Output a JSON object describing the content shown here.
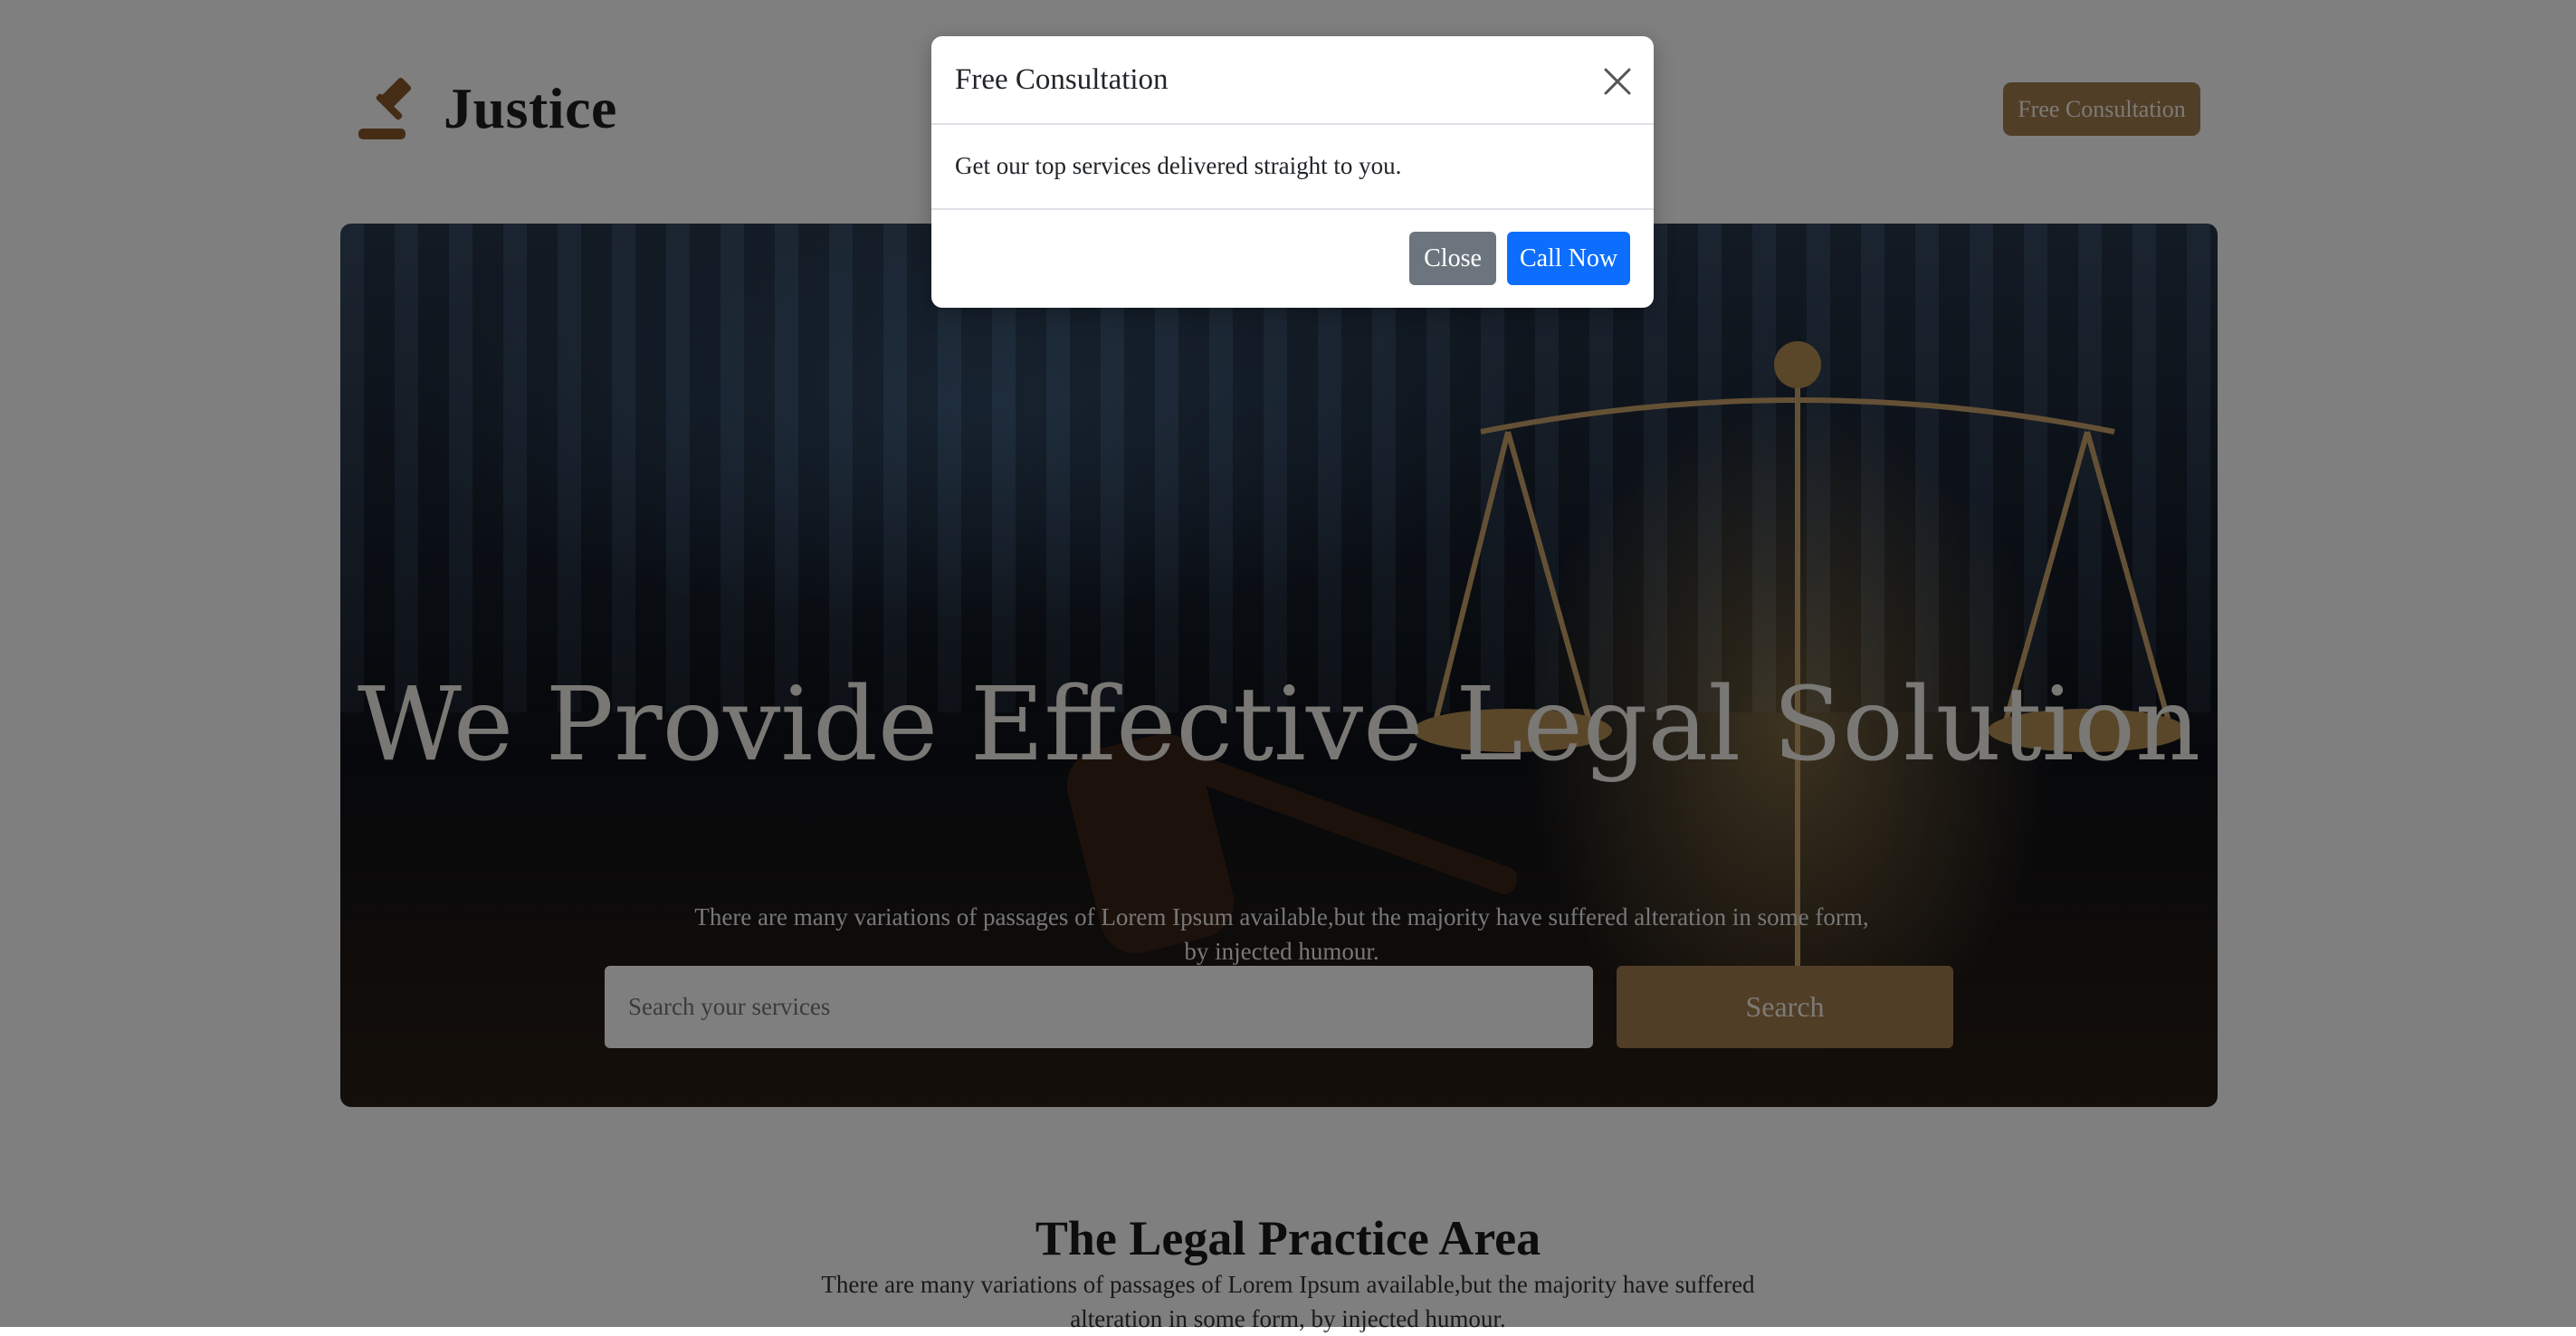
{
  "header": {
    "brand_name": "Justice",
    "logo_icon": "gavel-icon",
    "cta_label": "Free Consultation"
  },
  "hero": {
    "title": "We Provide Effective Legal Solution",
    "text": "There are many variations of passages of Lorem Ipsum available,but the majority have suffered alteration in some form, by injected humour.",
    "search_placeholder": "Search your services",
    "search_label": "Search"
  },
  "practice": {
    "title": "The Legal Practice Area",
    "text": "There are many variations of passages of Lorem Ipsum available,but the majority have suffered alteration in some form, by injected humour."
  },
  "modal": {
    "title": "Free Consultation",
    "body": "Get our top services delivered straight to you.",
    "close_icon": "close-icon",
    "close_label": "Close",
    "call_label": "Call Now"
  },
  "colors": {
    "brand_accent": "#a27c4f",
    "primary_button": "#0d6efd",
    "secondary_button": "#6c757d",
    "backdrop": "rgba(0,0,0,0.5)"
  }
}
